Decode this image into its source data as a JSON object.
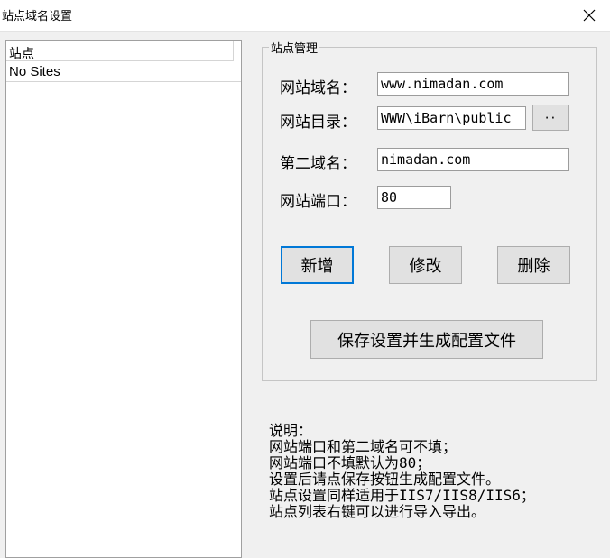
{
  "window": {
    "title": "站点域名设置",
    "close_icon": "close-icon"
  },
  "site_list": {
    "column_header": "站点",
    "rows": [
      "No Sites"
    ]
  },
  "site_manage": {
    "group_title": "站点管理",
    "fields": {
      "domain": {
        "label": "网站域名：",
        "value": "www.nimadan.com"
      },
      "directory": {
        "label": "网站目录：",
        "value": "WWW\\iBarn\\public",
        "browse_label": "··"
      },
      "second_domain": {
        "label": "第二域名：",
        "value": "nimadan.com"
      },
      "port": {
        "label": "网站端口：",
        "value": "80"
      }
    },
    "buttons": {
      "add": "新增",
      "modify": "修改",
      "delete": "删除",
      "save": "保存设置并生成配置文件"
    }
  },
  "notes": {
    "lines": [
      "说明：",
      "网站端口和第二域名可不填；",
      "网站端口不填默认为80；",
      "设置后请点保存按钮生成配置文件。",
      "站点设置同样适用于IIS7/IIS8/IIS6；",
      "站点列表右键可以进行导入导出。"
    ]
  }
}
